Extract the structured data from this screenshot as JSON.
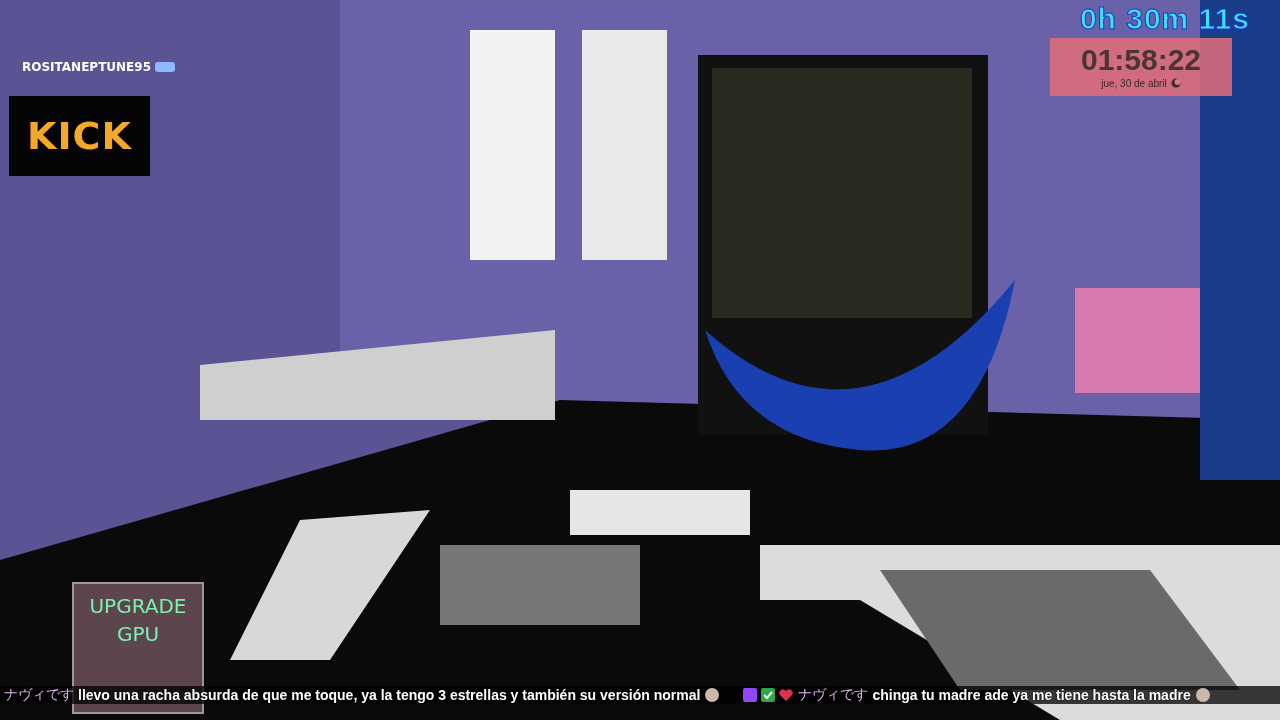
{
  "timer": "0h 30m 11s",
  "clock": {
    "time": "01:58:22",
    "date": "jue, 30 de abril"
  },
  "chat_user": {
    "name": "ROSITANEPTUNE95"
  },
  "kick_logo": "KICK",
  "upgrade_widget": {
    "lines": [
      "UPGRADE",
      "GPU"
    ]
  },
  "chat_ticker": [
    {
      "user": "ナヴィです",
      "message": "llevo una racha absurda de que me toque, ya la tengo 3 estrellas y también su versión normal",
      "badges": false
    },
    {
      "user": "ナヴィです",
      "message": "chinga tu madre ade ya me tiene hasta la madre",
      "badges": true
    }
  ]
}
